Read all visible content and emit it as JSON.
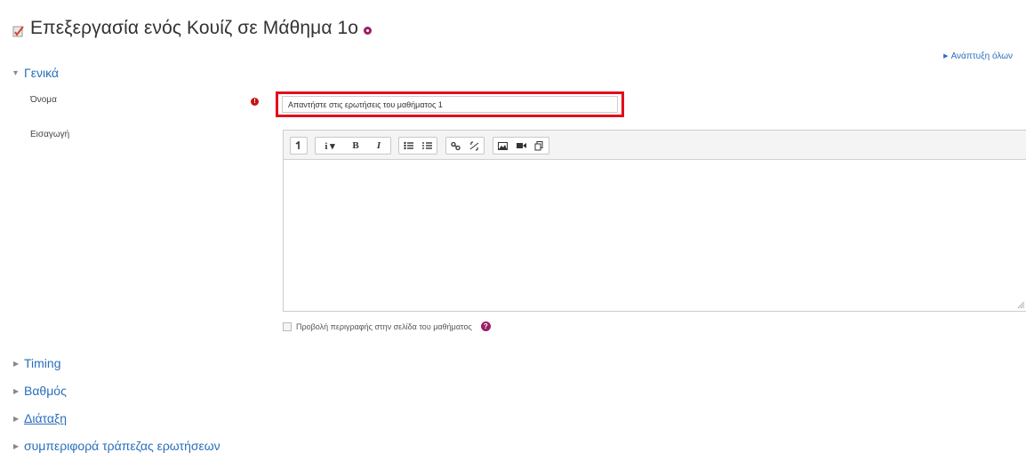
{
  "header": {
    "title": "Επεξεργασία ενός Κουίζ σε Μάθημα 1ο",
    "title_icon": "quiz-icon",
    "help_icon": "help-icon"
  },
  "expand_all": {
    "label": "Ανάπτυξη όλων"
  },
  "sections": [
    {
      "label": "Γενικά",
      "state": "expanded"
    },
    {
      "label": "Timing",
      "state": "collapsed"
    },
    {
      "label": "Βαθμός",
      "state": "collapsed"
    },
    {
      "label": "Διάταξη",
      "state": "collapsed"
    },
    {
      "label": "συμπεριφορά τράπεζας ερωτήσεων",
      "state": "collapsed"
    }
  ],
  "form": {
    "name": {
      "label": "Όνομα",
      "value": "Απαντήστε στις ερωτήσεις του μαθήματος 1",
      "required_icon": "required-icon",
      "highlight_color": "#e30d1b"
    },
    "intro": {
      "label": "Εισαγωγή",
      "toolbar": [
        [
          "collapse-toolbar-icon"
        ],
        [
          "style-icon",
          "bold-icon",
          "italic-icon"
        ],
        [
          "unordered-list-icon",
          "ordered-list-icon"
        ],
        [
          "link-icon",
          "unlink-icon"
        ],
        [
          "image-icon",
          "media-icon",
          "manage-files-icon"
        ]
      ],
      "value": ""
    },
    "show_description": {
      "label": "Προβολή περιγραφής στην σελίδα του μαθήματος",
      "checked": false
    }
  },
  "colors": {
    "link": "#2a6ebb",
    "help": "#9c1e66",
    "required": "#c31616"
  }
}
